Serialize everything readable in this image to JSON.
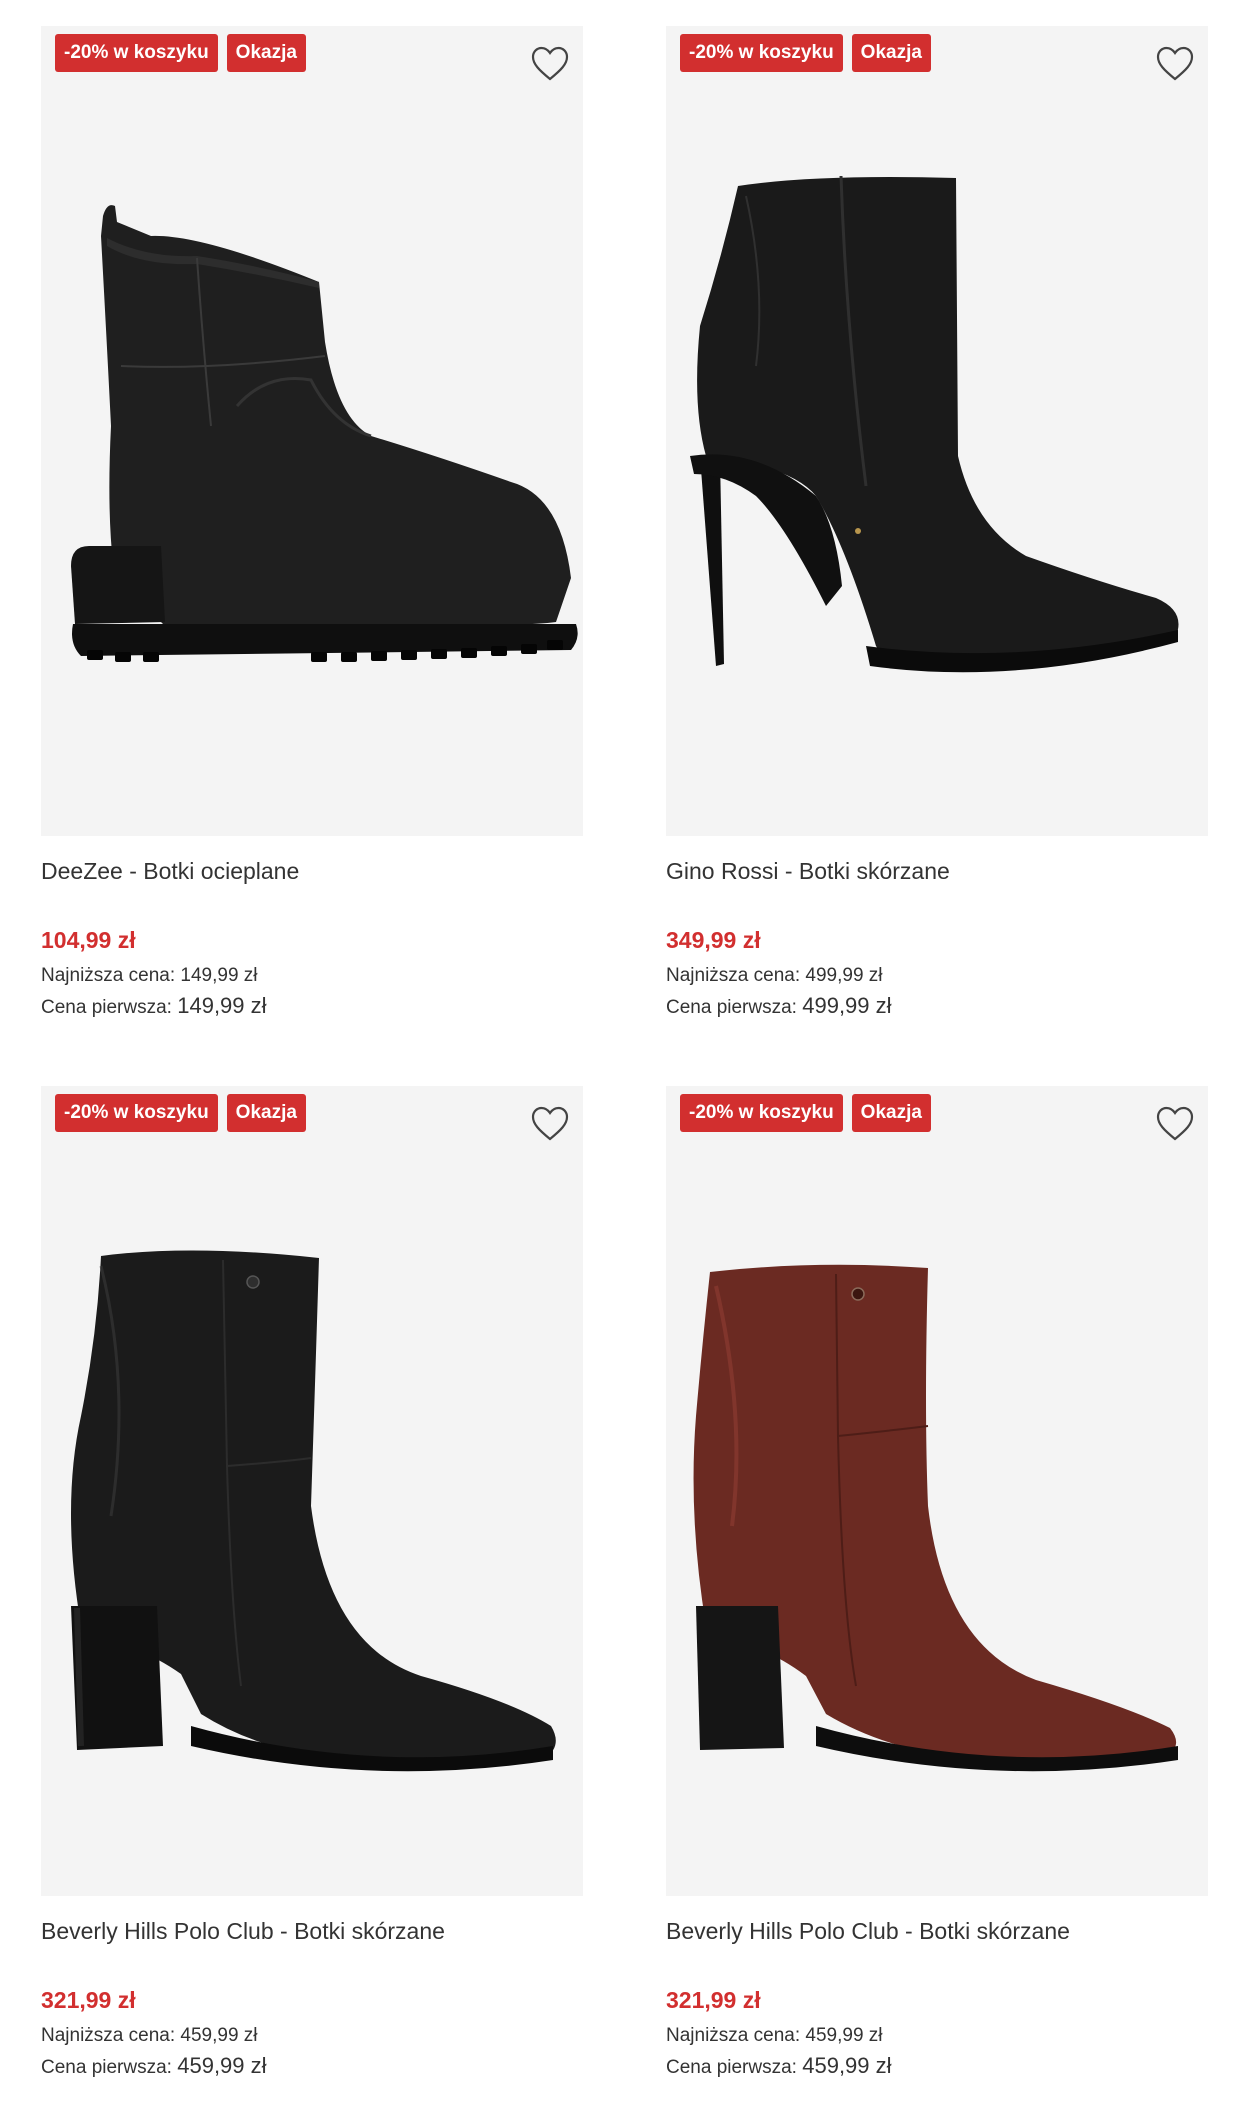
{
  "products": [
    {
      "title": "DeeZee - Botki ocieplane",
      "badges": [
        "-20% w koszyku",
        "Okazja"
      ],
      "price": "104,99 zł",
      "lowest_label": "Najniższa cena:",
      "lowest_value": "149,99 zł",
      "original_label": "Cena pierwsza:",
      "original_value": "149,99 zł",
      "icon": "heart-icon",
      "image": "black suede ankle boot with chunky lug sole"
    },
    {
      "title": "Gino Rossi - Botki skórzane",
      "badges": [
        "-20% w koszyku",
        "Okazja"
      ],
      "price": "349,99 zł",
      "lowest_label": "Najniższa cena:",
      "lowest_value": "499,99 zł",
      "original_label": "Cena pierwsza:",
      "original_value": "499,99 zł",
      "icon": "heart-icon",
      "image": "black leather stiletto ankle boot"
    },
    {
      "title": "Beverly Hills Polo Club - Botki skórzane",
      "badges": [
        "-20% w koszyku",
        "Okazja"
      ],
      "price": "321,99 zł",
      "lowest_label": "Najniższa cena:",
      "lowest_value": "459,99 zł",
      "original_label": "Cena pierwsza:",
      "original_value": "459,99 zł",
      "icon": "heart-icon",
      "image": "black leather block heel ankle boot"
    },
    {
      "title": "Beverly Hills Polo Club - Botki skórzane",
      "badges": [
        "-20% w koszyku",
        "Okazja"
      ],
      "price": "321,99 zł",
      "lowest_label": "Najniższa cena:",
      "lowest_value": "459,99 zł",
      "original_label": "Cena pierwsza:",
      "original_value": "459,99 zł",
      "icon": "heart-icon",
      "image": "burgundy leather block heel ankle boot"
    }
  ],
  "colors": {
    "accent_red": "#d22f2f",
    "card_bg": "#f4f4f4",
    "text": "#333333",
    "boot_burgundy": "#6b2a22"
  }
}
